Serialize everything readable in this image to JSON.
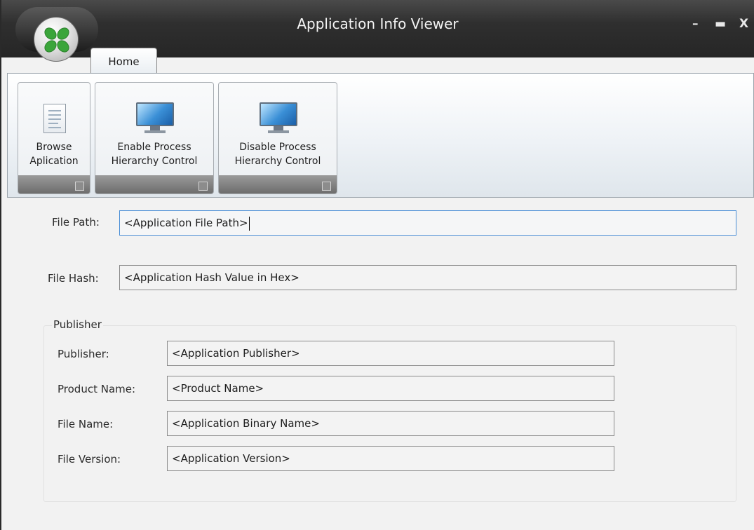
{
  "window": {
    "title": "Application Info Viewer",
    "controls": {
      "minimize": "–",
      "maximize": "▬",
      "close": "X"
    }
  },
  "ribbon": {
    "tabs": [
      {
        "label": "Home",
        "active": true
      }
    ],
    "groups": [
      {
        "label": "Browse\nAplication",
        "icon": "document-icon"
      },
      {
        "label": "Enable Process\nHierarchy Control",
        "icon": "monitor-icon"
      },
      {
        "label": "Disable Process\nHierarchy Control",
        "icon": "monitor-icon"
      }
    ]
  },
  "form": {
    "file_path": {
      "label": "File Path:",
      "value": "<Application File Path>"
    },
    "file_hash": {
      "label": "File Hash:",
      "value": "<Application Hash Value in Hex>"
    },
    "publisher_group": {
      "title": "Publisher",
      "fields": [
        {
          "label": "Publisher:",
          "value": "<Application Publisher>"
        },
        {
          "label": "Product Name:",
          "value": "<Product Name>"
        },
        {
          "label": "File Name:",
          "value": "<Application Binary Name>"
        },
        {
          "label": "File Version:",
          "value": "<Application Version>"
        }
      ]
    }
  },
  "colors": {
    "titlebar": "#2f2f2f",
    "focus_border": "#4a8ed6",
    "ribbon_bar": "#7d7d7d"
  }
}
